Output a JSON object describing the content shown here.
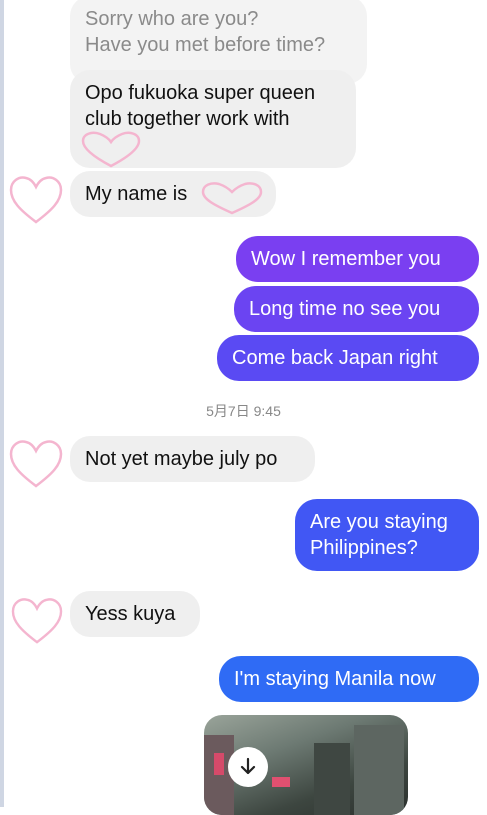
{
  "messages": {
    "m1_line1": "Sorry who are you?",
    "m1_line2": "Have you met before time?",
    "m2_line1": "Opo fukuoka super queen",
    "m2_line2": "club together work with",
    "m3": "My name is",
    "m4": "Wow I remember you",
    "m5": "Long time no see you",
    "m6": "Come back Japan right",
    "m7": "Not yet maybe july po",
    "m8_line1": "Are you staying",
    "m8_line2": "Philippines?",
    "m9": "Yess kuya",
    "m10": "I'm staying Manila now"
  },
  "timestamp": "5月7日 9:45",
  "colors": {
    "incoming_bg": "#efefef",
    "outgoing_top": "#7b3ff2",
    "outgoing_bottom": "#2f6bf5",
    "heart": "#f4b5cf"
  },
  "icons": {
    "heart": "heart-sticker-icon",
    "download": "download-arrow-icon"
  }
}
